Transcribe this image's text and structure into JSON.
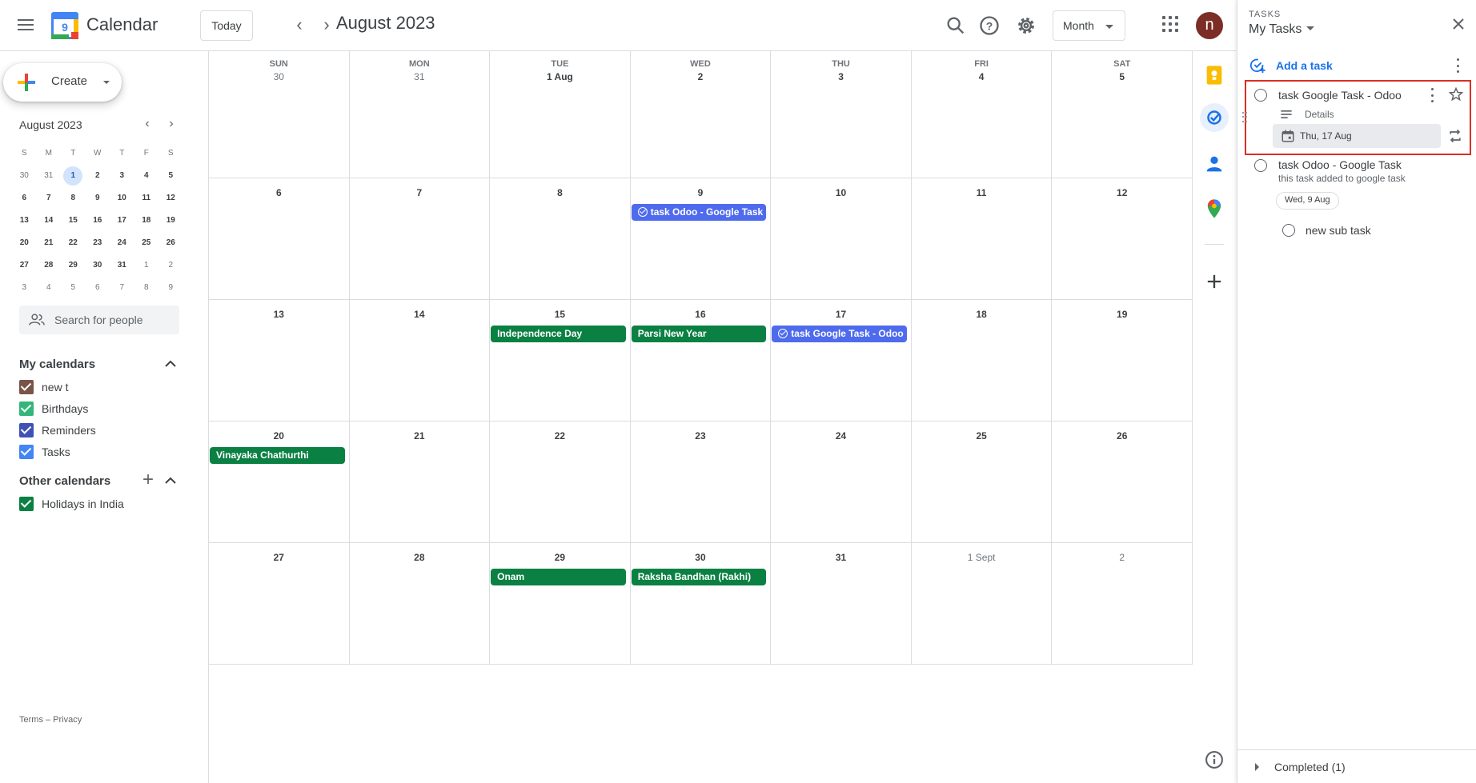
{
  "header": {
    "app_title": "Calendar",
    "logo_day": "9",
    "today_label": "Today",
    "month_title": "August 2023",
    "view_label": "Month",
    "avatar_letter": "n"
  },
  "sidebar": {
    "create_label": "Create",
    "mini_title": "August 2023",
    "mini_dow": [
      "S",
      "M",
      "T",
      "W",
      "T",
      "F",
      "S"
    ],
    "mini_weeks": [
      [
        "30",
        "31",
        "1",
        "2",
        "3",
        "4",
        "5"
      ],
      [
        "6",
        "7",
        "8",
        "9",
        "10",
        "11",
        "12"
      ],
      [
        "13",
        "14",
        "15",
        "16",
        "17",
        "18",
        "19"
      ],
      [
        "20",
        "21",
        "22",
        "23",
        "24",
        "25",
        "26"
      ],
      [
        "27",
        "28",
        "29",
        "30",
        "31",
        "1",
        "2"
      ],
      [
        "3",
        "4",
        "5",
        "6",
        "7",
        "8",
        "9"
      ]
    ],
    "search_placeholder": "Search for people",
    "my_calendars_title": "My calendars",
    "my_calendars": [
      {
        "label": "new t",
        "color": "#795548"
      },
      {
        "label": "Birthdays",
        "color": "#33b679"
      },
      {
        "label": "Reminders",
        "color": "#3f51b5"
      },
      {
        "label": "Tasks",
        "color": "#4285f4"
      }
    ],
    "other_calendars_title": "Other calendars",
    "other_calendars": [
      {
        "label": "Holidays in India",
        "color": "#0b8043"
      }
    ],
    "footer": "Terms – Privacy"
  },
  "grid": {
    "dow": [
      "SUN",
      "MON",
      "TUE",
      "WED",
      "THU",
      "FRI",
      "SAT"
    ],
    "weeks": [
      [
        "30",
        "31",
        "1 Aug",
        "2",
        "3",
        "4",
        "5"
      ],
      [
        "6",
        "7",
        "8",
        "9",
        "10",
        "11",
        "12"
      ],
      [
        "13",
        "14",
        "15",
        "16",
        "17",
        "18",
        "19"
      ],
      [
        "20",
        "21",
        "22",
        "23",
        "24",
        "25",
        "26"
      ],
      [
        "27",
        "28",
        "29",
        "30",
        "31",
        "1 Sept",
        "2"
      ]
    ],
    "events": [
      {
        "week": 1,
        "day": 3,
        "label": "task Odoo - Google Task",
        "kind": "task"
      },
      {
        "week": 2,
        "day": 2,
        "label": "Independence Day",
        "kind": "holiday"
      },
      {
        "week": 2,
        "day": 3,
        "label": "Parsi New Year",
        "kind": "holiday"
      },
      {
        "week": 2,
        "day": 4,
        "label": "task Google Task - Odoo",
        "kind": "task"
      },
      {
        "week": 3,
        "day": 0,
        "label": "Vinayaka Chathurthi",
        "kind": "holiday"
      },
      {
        "week": 4,
        "day": 2,
        "label": "Onam",
        "kind": "holiday"
      },
      {
        "week": 4,
        "day": 3,
        "label": "Raksha Bandhan (Rakhi)",
        "kind": "holiday"
      }
    ]
  },
  "tasks": {
    "overline": "TASKS",
    "list_title": "My Tasks",
    "add_label": "Add a task",
    "items": [
      {
        "title": "task Google Task - Odoo",
        "details_label": "Details",
        "date": "Thu, 17 Aug"
      },
      {
        "title": "task Odoo - Google Task",
        "description": "this task added to google task",
        "date": "Wed, 9 Aug",
        "subtask": "new sub task"
      }
    ],
    "completed_label": "Completed (1)"
  }
}
